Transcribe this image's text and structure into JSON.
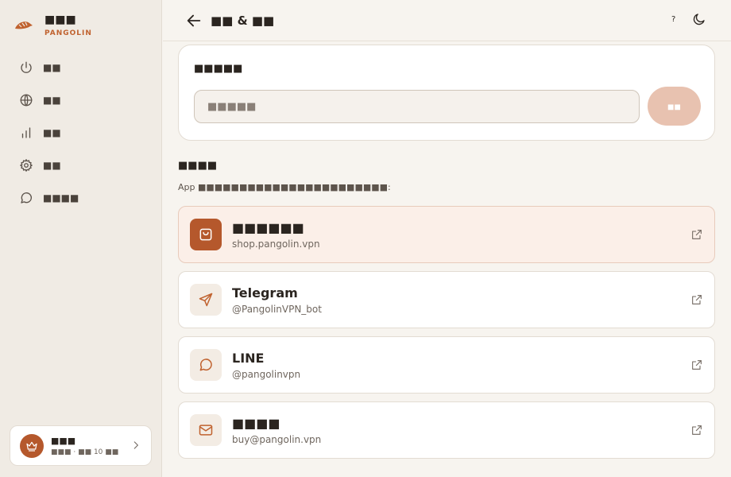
{
  "brand": {
    "name": "■■■",
    "sub": "PANGOLIN"
  },
  "nav": {
    "items": [
      {
        "label": "■■",
        "icon": "power-icon"
      },
      {
        "label": "■■",
        "icon": "globe-icon"
      },
      {
        "label": "■■",
        "icon": "bar-chart-icon"
      },
      {
        "label": "■■",
        "icon": "gear-icon"
      },
      {
        "label": "■■■■",
        "icon": "chat-bubble-icon"
      }
    ]
  },
  "plan": {
    "name": "■■■",
    "meta": "■■■ · ■■ 10 ■■",
    "icon": "crown-icon"
  },
  "header": {
    "title": "■■ & ■■",
    "lang_label": "?"
  },
  "promo": {
    "title": "■■■■■",
    "placeholder": "■■■■■",
    "button_label": "■■"
  },
  "channels_section": {
    "title": "■■■■",
    "description": "App ■■■■■■■■■■■■■■■■■■■■■■■:"
  },
  "channels": [
    {
      "name": "■■■■■■",
      "sub": "shop.pangolin.vpn",
      "icon": "shopping-bag-icon",
      "highlight": true
    },
    {
      "name": "Telegram",
      "sub": "@PangolinVPN_bot",
      "icon": "send-icon"
    },
    {
      "name": "LINE",
      "sub": "@pangolinvpn",
      "icon": "chat-bubble-icon"
    },
    {
      "name": "■■■■",
      "sub": "buy@pangolin.vpn",
      "icon": "mail-icon"
    }
  ],
  "colors": {
    "accent": "#b5582c",
    "accent_light": "#e8c2b0",
    "background": "#f7f4ef",
    "sidebar": "#f0ebe4"
  }
}
